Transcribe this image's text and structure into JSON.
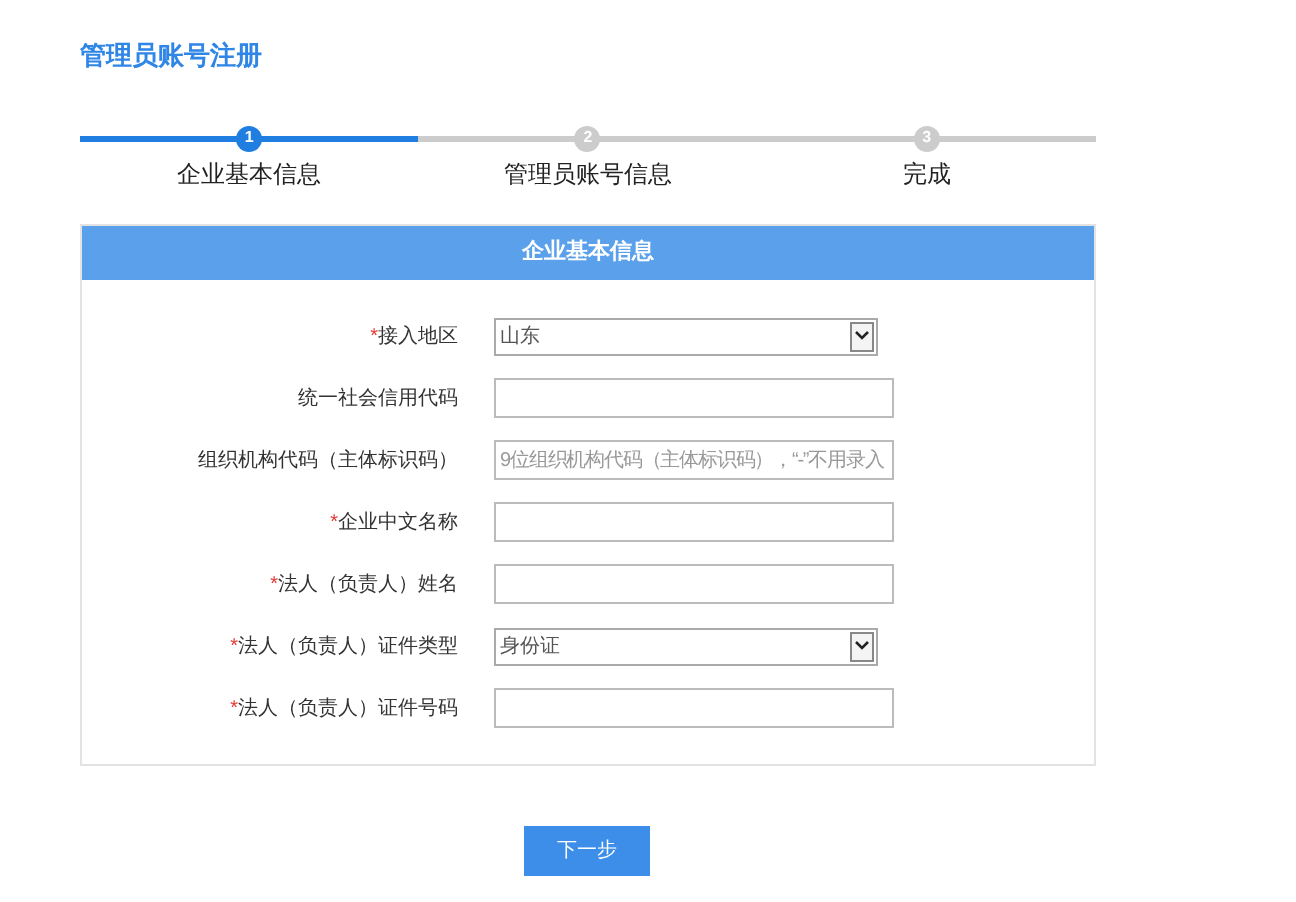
{
  "page_title": "管理员账号注册",
  "steps": [
    {
      "number": "1",
      "label": "企业基本信息",
      "active": true
    },
    {
      "number": "2",
      "label": "管理员账号信息",
      "active": false
    },
    {
      "number": "3",
      "label": "完成",
      "active": false
    }
  ],
  "panel": {
    "title": "企业基本信息",
    "fields": [
      {
        "mark": "*",
        "label": "接入地区",
        "kind": "select",
        "value": "山东"
      },
      {
        "label": "统一社会信用代码",
        "kind": "input"
      },
      {
        "label": "组织机构代码（主体标识码）",
        "kind": "input",
        "placeholder": "9位组织机构代码（主体标识码），“-”不用录入"
      },
      {
        "mark": "*",
        "label": "企业中文名称",
        "kind": "input"
      },
      {
        "mark": "*",
        "label": "法人（负责人）姓名",
        "kind": "input"
      },
      {
        "mark": "*",
        "label": "法人（负责人）证件类型",
        "kind": "select",
        "value": "身份证"
      },
      {
        "mark": "*",
        "label": "法人（负责人）证件号码",
        "kind": "input"
      }
    ]
  },
  "next_button": "下一步"
}
